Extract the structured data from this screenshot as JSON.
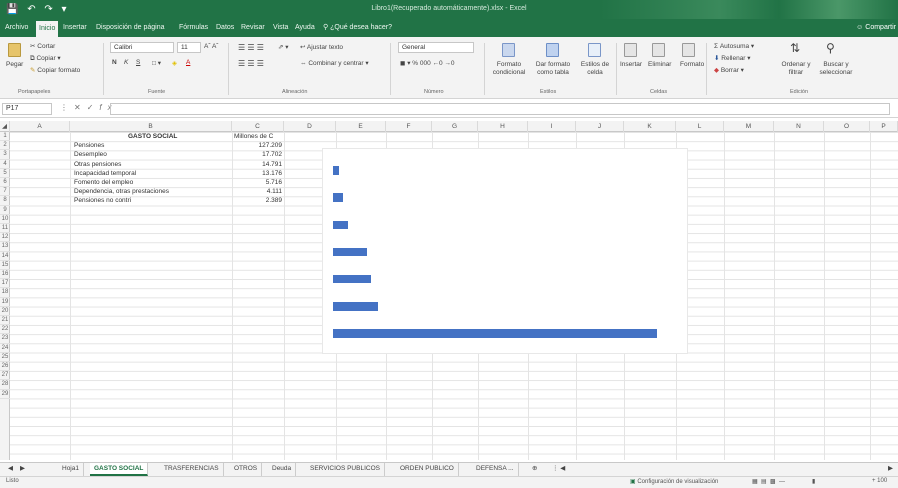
{
  "window": {
    "title": "Libro1(Recuperado automáticamente).xlsx  -  Excel",
    "share_label": "Compartir"
  },
  "menu": {
    "tabs": [
      "Archivo",
      "Inicio",
      "Insertar",
      "Disposición de página",
      "Fórmulas",
      "Datos",
      "Revisar",
      "Vista",
      "Ayuda"
    ],
    "tell_me": "¿Qué desea hacer?"
  },
  "ribbon": {
    "clipboard": {
      "paste": "Pegar",
      "cut": "Cortar",
      "copy": "Copiar",
      "format_painter": "Copiar formato",
      "group": "Portapapeles"
    },
    "font": {
      "name": "Calibri",
      "size": "11",
      "group": "Fuente",
      "bold": "N",
      "italic": "K",
      "underline": "S"
    },
    "alignment": {
      "wrap": "Ajustar texto",
      "merge": "Combinar y centrar",
      "group": "Alineación"
    },
    "number": {
      "format": "General",
      "group": "Número"
    },
    "styles": {
      "conditional": "Formato condicional",
      "as_table": "Dar formato como tabla",
      "cell_styles": "Estilos de celda",
      "group": "Estilos"
    },
    "cells": {
      "insert": "Insertar",
      "delete": "Eliminar",
      "format": "Formato",
      "group": "Celdas"
    },
    "editing": {
      "autosum": "Autosuma",
      "fill": "Rellenar",
      "clear": "Borrar",
      "sort": "Ordenar y filtrar",
      "find": "Buscar y seleccionar",
      "group": "Edición"
    }
  },
  "formula_bar": {
    "name_box": "P17",
    "value": ""
  },
  "columns": [
    "A",
    "B",
    "C",
    "D",
    "E",
    "F",
    "G",
    "H",
    "I",
    "J",
    "K",
    "L",
    "M",
    "N",
    "O",
    "P"
  ],
  "rows": [
    "1",
    "2",
    "3",
    "4",
    "5",
    "6",
    "7",
    "8",
    "9",
    "10",
    "11",
    "12",
    "13",
    "14",
    "15",
    "16",
    "17",
    "18",
    "19",
    "20",
    "21",
    "22",
    "23",
    "24",
    "25",
    "26",
    "27",
    "28",
    "29"
  ],
  "table": {
    "header_b": "GASTO SOCIAL",
    "header_c": "Millones de C",
    "rows": [
      {
        "label": "Pensiones",
        "value": "127.209"
      },
      {
        "label": "Desempleo",
        "value": "17.702"
      },
      {
        "label": "Otras pensiones",
        "value": "14.791"
      },
      {
        "label": "Incapacidad temporal",
        "value": "13.176"
      },
      {
        "label": "Fomento del empleo",
        "value": "5.716"
      },
      {
        "label": "Dependencia, otras prestaciones",
        "value": "4.111"
      },
      {
        "label": "Pensiones no contri",
        "value": "2.389"
      }
    ]
  },
  "chart_data": {
    "type": "bar",
    "orientation": "horizontal",
    "categories": [
      "Pensiones no contri",
      "Dependencia, otras prestaciones",
      "Fomento del empleo",
      "Incapacidad temporal",
      "Otras pensiones",
      "Desempleo",
      "Pensiones"
    ],
    "values": [
      2389,
      4111,
      5716,
      13176,
      14791,
      17702,
      127209
    ],
    "color": "#4472c4",
    "xlim": [
      0,
      136000
    ]
  },
  "sheets": [
    "Hoja1",
    "GASTO SOCIAL",
    "TRASFERENCIAS",
    "OTROS",
    "Deuda",
    "SERVICIOS PUBLICOS",
    "ORDEN PUBLICO",
    "DEFENSA ..."
  ],
  "active_sheet": "GASTO SOCIAL",
  "status": {
    "mode": "Listo",
    "display_settings": "Configuración de visualización",
    "zoom": "+ 100"
  }
}
